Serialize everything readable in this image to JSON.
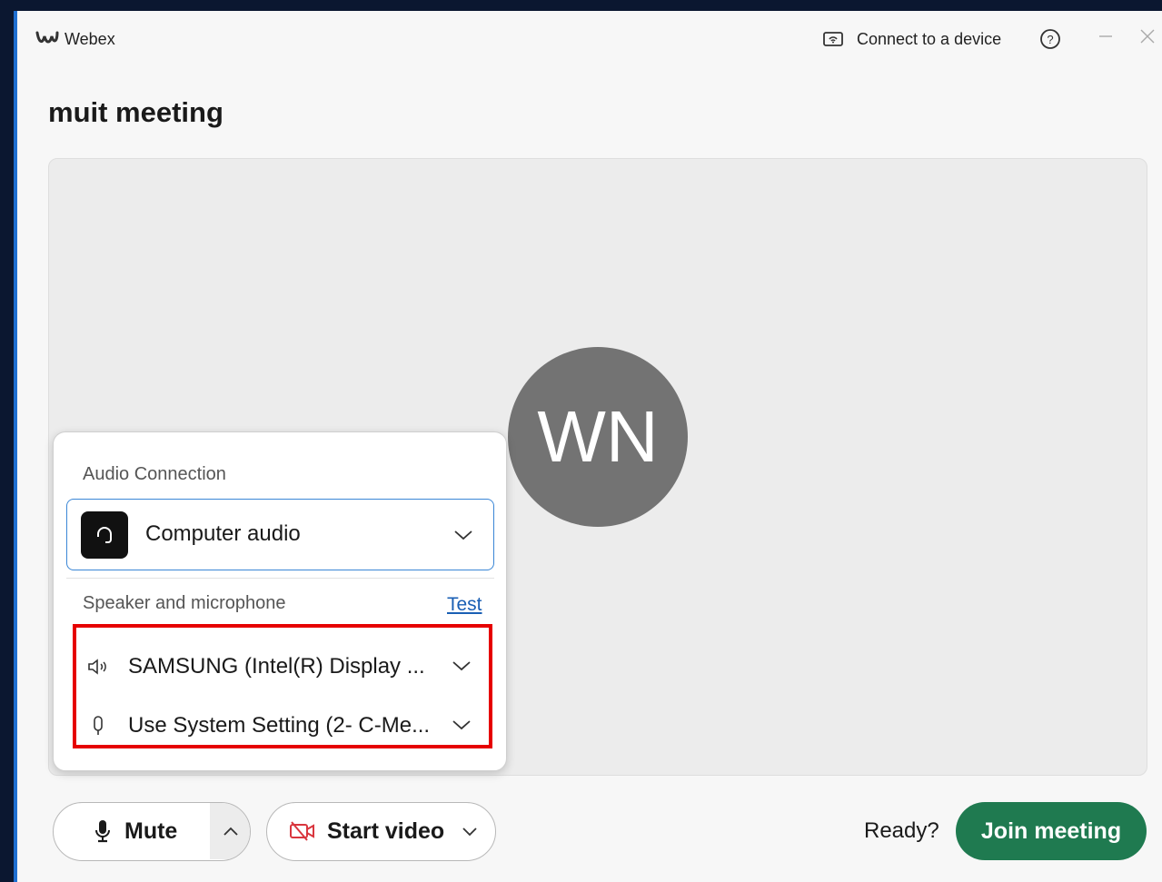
{
  "window": {
    "app_name": "Webex",
    "connect_device_label": "Connect to a device",
    "meeting_title": "muit meeting"
  },
  "preview": {
    "avatar_initials": "WN"
  },
  "audio_popup": {
    "audio_connection_label": "Audio Connection",
    "audio_connection_value": "Computer audio",
    "speaker_mic_label": "Speaker and microphone",
    "test_link": "Test",
    "speaker_device": "SAMSUNG (Intel(R) Display ...",
    "microphone_device": "Use System Setting (2- C-Me..."
  },
  "controls": {
    "mute_label": "Mute",
    "video_label": "Start video",
    "ready_text": "Ready?",
    "join_label": "Join meeting"
  },
  "colors": {
    "join_green": "#1f7a50",
    "highlight_red": "#e60000",
    "link_blue": "#1a5fb4",
    "window_accent": "#1f6fd1"
  },
  "icons": {
    "logo": "webex-logo-icon",
    "connect": "cast-device-icon",
    "help": "help-icon",
    "minimize": "minimize-icon",
    "close": "close-icon",
    "headset": "headset-icon",
    "speaker": "speaker-icon",
    "microphone": "microphone-icon",
    "video_off": "video-off-icon"
  }
}
